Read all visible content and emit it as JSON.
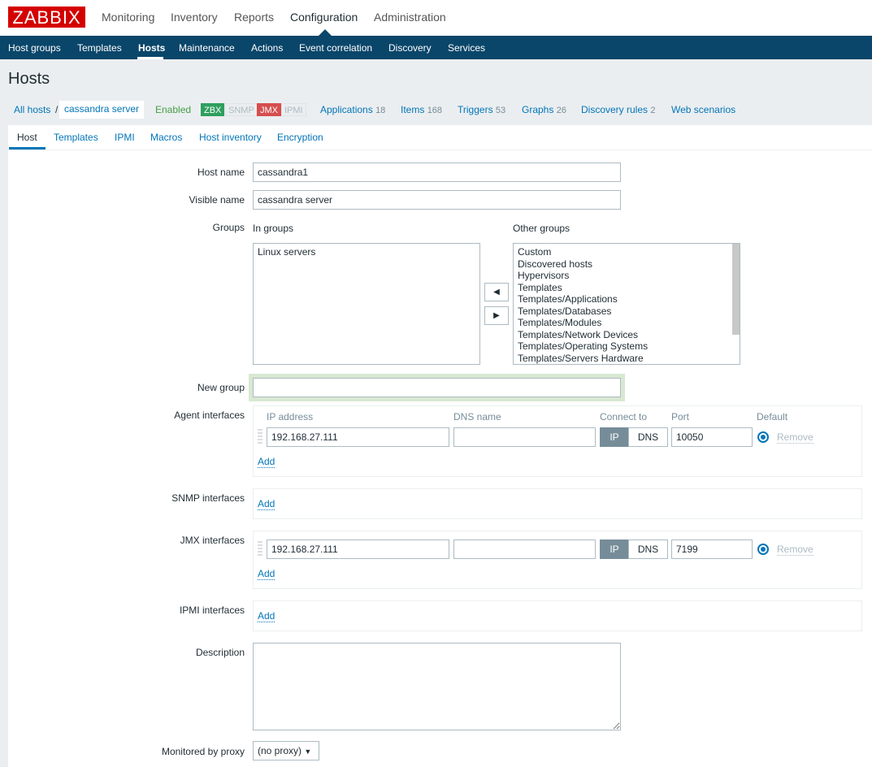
{
  "logo": "ZABBIX",
  "main_menu": [
    "Monitoring",
    "Inventory",
    "Reports",
    "Configuration",
    "Administration"
  ],
  "sub_menu": [
    "Host groups",
    "Templates",
    "Hosts",
    "Maintenance",
    "Actions",
    "Event correlation",
    "Discovery",
    "Services"
  ],
  "page_title": "Hosts",
  "header": {
    "all_hosts": "All hosts",
    "separator": "/",
    "host": "cassandra server",
    "status": "Enabled",
    "badges": [
      {
        "label": "ZBX",
        "color": "#2f9f5e"
      },
      {
        "label": "SNMP",
        "color": ""
      },
      {
        "label": "JMX",
        "color": "#d64e4e"
      },
      {
        "label": "IPMI",
        "color": ""
      }
    ],
    "links": [
      {
        "label": "Applications",
        "count": "18"
      },
      {
        "label": "Items",
        "count": "168"
      },
      {
        "label": "Triggers",
        "count": "53"
      },
      {
        "label": "Graphs",
        "count": "26"
      },
      {
        "label": "Discovery rules",
        "count": "2"
      },
      {
        "label": "Web scenarios",
        "count": ""
      }
    ]
  },
  "tabs": [
    "Host",
    "Templates",
    "IPMI",
    "Macros",
    "Host inventory",
    "Encryption"
  ],
  "form": {
    "host_name_label": "Host name",
    "host_name": "cassandra1",
    "visible_name_label": "Visible name",
    "visible_name": "cassandra server",
    "groups_label": "Groups",
    "in_groups_label": "In groups",
    "other_groups_label": "Other groups",
    "in_groups": [
      "Linux servers"
    ],
    "other_groups": [
      "Custom",
      "Discovered hosts",
      "Hypervisors",
      "Templates",
      "Templates/Applications",
      "Templates/Databases",
      "Templates/Modules",
      "Templates/Network Devices",
      "Templates/Operating Systems",
      "Templates/Servers Hardware"
    ],
    "new_group_label": "New group",
    "new_group": "",
    "agent_label": "Agent interfaces",
    "col_ip": "IP address",
    "col_dns": "DNS name",
    "col_connect": "Connect to",
    "col_port": "Port",
    "col_default": "Default",
    "agent": {
      "ip": "192.168.27.111",
      "dns": "",
      "port": "10050"
    },
    "btn_ip": "IP",
    "btn_dns": "DNS",
    "remove": "Remove",
    "add": "Add",
    "snmp_label": "SNMP interfaces",
    "jmx_label": "JMX interfaces",
    "jmx": {
      "ip": "192.168.27.111",
      "dns": "",
      "port": "7199"
    },
    "ipmi_label": "IPMI interfaces",
    "description_label": "Description",
    "description": "",
    "proxy_label": "Monitored by proxy",
    "proxy": "(no proxy)"
  }
}
